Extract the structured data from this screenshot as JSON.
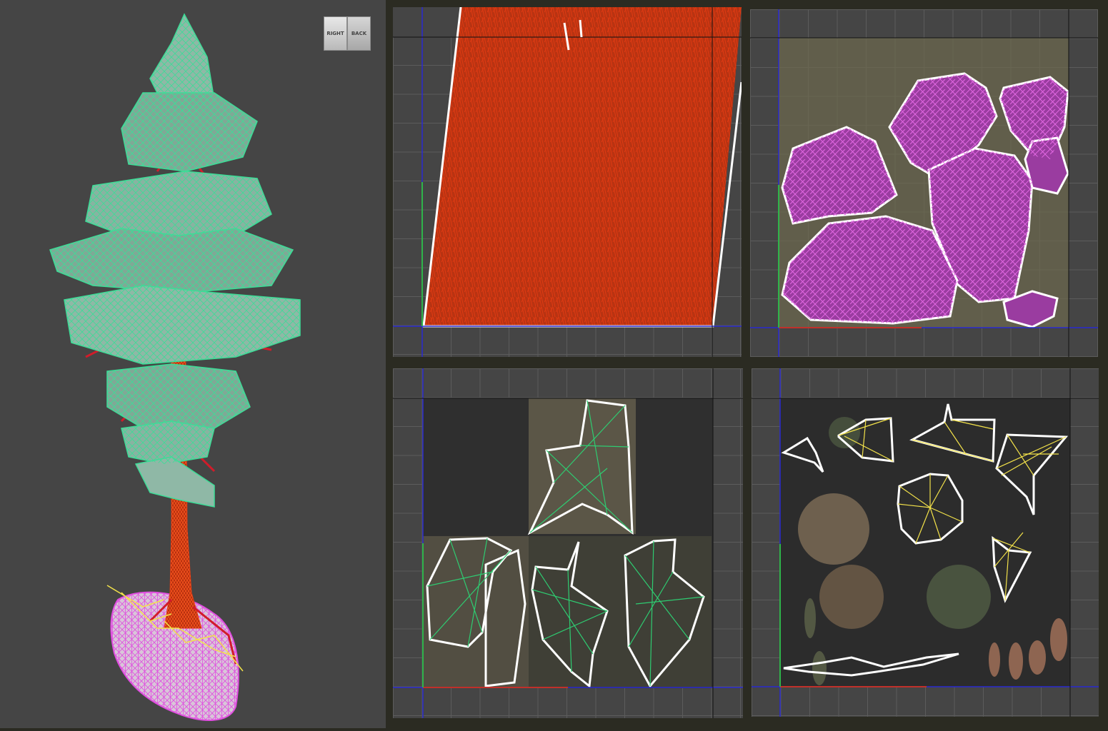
{
  "viewcube": {
    "right_label": "RIGHT",
    "back_label": "BACK"
  },
  "colors": {
    "background": "#2b2b22",
    "viewport": "#454545",
    "bark_wire": "#e03a12",
    "foliage_wire": "#3ddc97",
    "rock_wire": "#e04ee0",
    "leaf_wire": "#2ecc71",
    "grass_wire": "#f3e24a",
    "island_outline": "#ffffff",
    "u_axis": "#c0302a",
    "v_axis": "#2fb34a",
    "frame_axis": "#2a2ad0"
  },
  "panels": [
    {
      "id": "uv-bark",
      "name": "bark-uv-panel"
    },
    {
      "id": "uv-rock",
      "name": "rock-uv-panel"
    },
    {
      "id": "uv-leaves",
      "name": "leaves-uv-panel"
    },
    {
      "id": "uv-foliage",
      "name": "foliage-uv-panel"
    }
  ]
}
